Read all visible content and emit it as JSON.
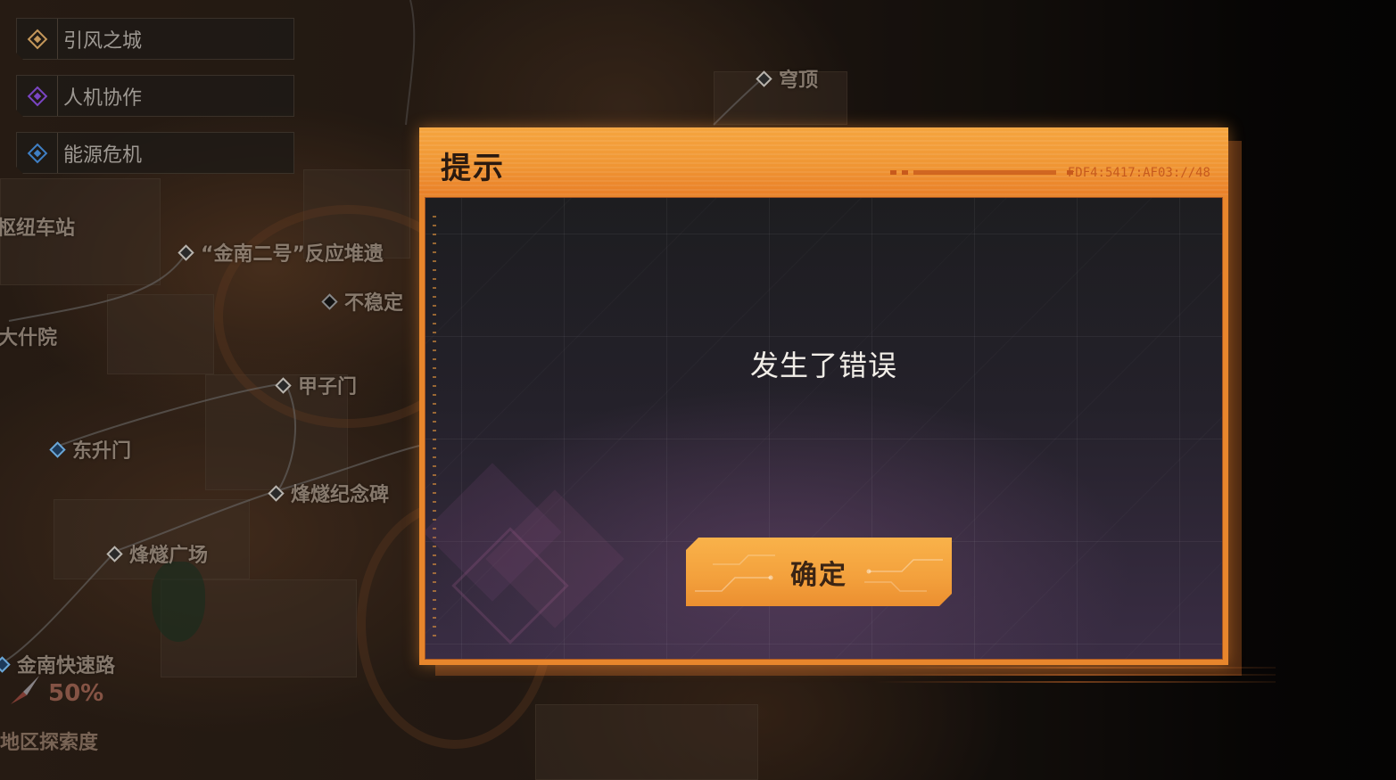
{
  "missions": [
    {
      "label": "引风之城",
      "icon": "gold-diamond-icon",
      "color": "#d9a54a"
    },
    {
      "label": "人机协作",
      "icon": "purple-diamond-icon",
      "color": "#8a4fd6"
    },
    {
      "label": "能源危机",
      "icon": "blue-diamond-icon",
      "color": "#4a90d9"
    }
  ],
  "map": {
    "pois": [
      {
        "label": "枢纽车站"
      },
      {
        "label": "“金南二号”反应堆遗"
      },
      {
        "label": "不稳定"
      },
      {
        "label": "大什院"
      },
      {
        "label": "甲子门"
      },
      {
        "label": "东升门"
      },
      {
        "label": "烽燧纪念碑"
      },
      {
        "label": "烽燧广场"
      },
      {
        "label": "金南快速路"
      },
      {
        "label": "穹顶"
      }
    ],
    "exploration_percent": "50%",
    "exploration_label": "地区探索度"
  },
  "dialog": {
    "title": "提示",
    "code": "FDF4:5417:AF03://48",
    "message": "发生了错误",
    "confirm_label": "确定",
    "accent_color": "#f09634"
  }
}
